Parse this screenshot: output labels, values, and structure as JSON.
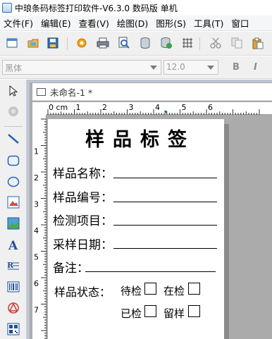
{
  "window": {
    "title": "中琅条码标签打印软件-V6.3.0 数码版 单机"
  },
  "menu": {
    "items": [
      {
        "label": "文件(F)"
      },
      {
        "label": "编辑(E)"
      },
      {
        "label": "查看(V)"
      },
      {
        "label": "绘图(D)"
      },
      {
        "label": "图形(S)"
      },
      {
        "label": "工具(T)"
      },
      {
        "label": "窗口"
      }
    ]
  },
  "toolbar": {
    "icons": [
      "new-icon",
      "open-icon",
      "save-icon",
      "settings-icon",
      "print-icon",
      "print-preview-icon",
      "database-icon",
      "database-settings-icon",
      "grid-icon",
      "cut-icon",
      "copy-icon",
      "paste-icon"
    ]
  },
  "fontbar": {
    "font_value": "黑体",
    "size_value": "12.0",
    "bold_label": "B",
    "italic_label": "I"
  },
  "tools": {
    "icons": [
      "select-icon",
      "pan-icon",
      "line-icon",
      "rounded-rect-icon",
      "ellipse-icon",
      "image-icon",
      "picture-icon",
      "text-icon",
      "rich-text-icon",
      "barcode-icon",
      "shape-icon",
      "qrcode-icon"
    ]
  },
  "document": {
    "tab_title": "未命名-1 *",
    "ruler_unit": "0 cm",
    "ruler_h_numbers": [
      "1",
      "2",
      "3",
      "4",
      "5",
      "6"
    ],
    "ruler_v_numbers": [
      "1",
      "2",
      "3",
      "4",
      "5",
      "6",
      "7"
    ]
  },
  "label": {
    "title": "样品标签",
    "fields": [
      {
        "label": "样品名称："
      },
      {
        "label": "样品编号："
      },
      {
        "label": "检测项目："
      },
      {
        "label": "采样日期："
      },
      {
        "label": "备注："
      }
    ],
    "status_label": "样品状态：",
    "status_options": [
      {
        "label": "待检"
      },
      {
        "label": "在检"
      },
      {
        "label": "已检"
      },
      {
        "label": "留样"
      }
    ]
  }
}
